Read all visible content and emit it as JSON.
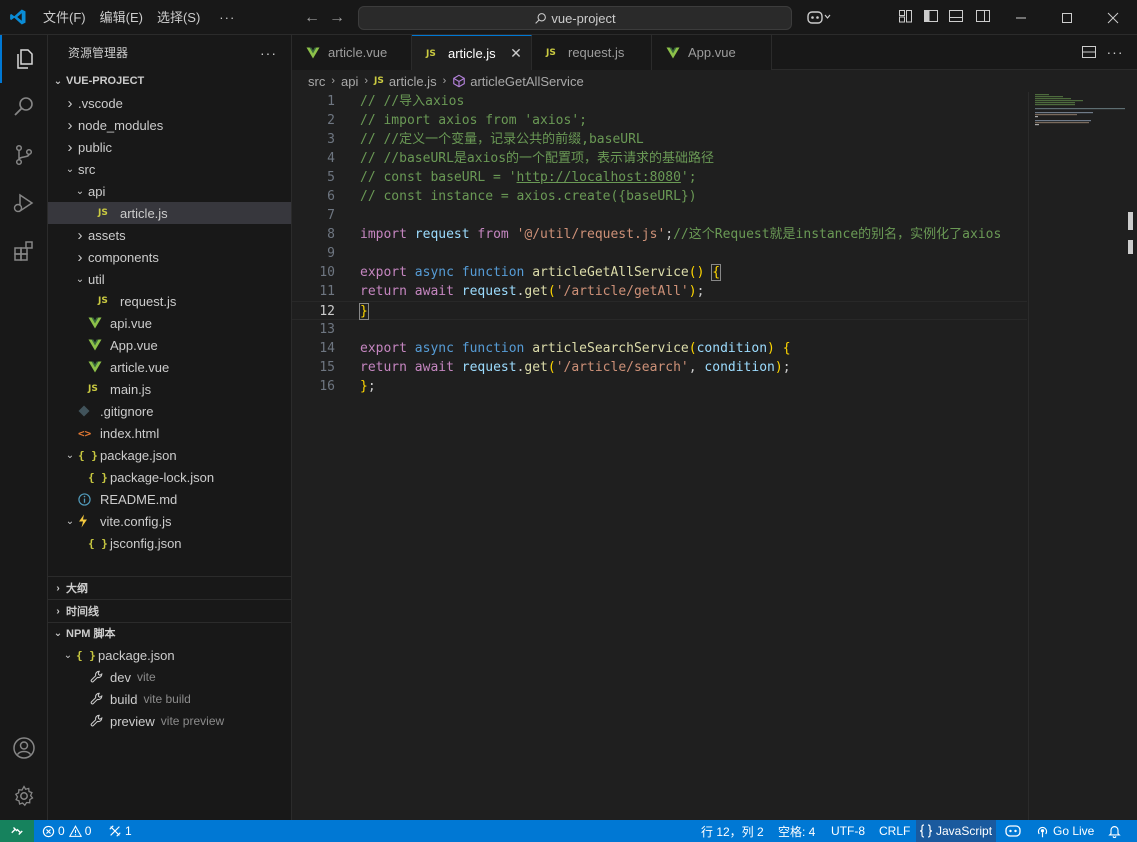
{
  "titlebar": {
    "menus": [
      "文件(F)",
      "编辑(E)",
      "选择(S)",
      "···"
    ],
    "search_text": "vue-project"
  },
  "sidebar": {
    "title": "资源管理器",
    "more": "···",
    "project": "VUE-PROJECT",
    "tree": [
      {
        "label": ".vscode",
        "indent": 1,
        "chev": "right",
        "icon": ""
      },
      {
        "label": "node_modules",
        "indent": 1,
        "chev": "right",
        "icon": ""
      },
      {
        "label": "public",
        "indent": 1,
        "chev": "right",
        "icon": ""
      },
      {
        "label": "src",
        "indent": 1,
        "chev": "down",
        "icon": ""
      },
      {
        "label": "api",
        "indent": 2,
        "chev": "down",
        "icon": ""
      },
      {
        "label": "article.js",
        "indent": 3,
        "chev": "",
        "icon": "js",
        "selected": true
      },
      {
        "label": "assets",
        "indent": 2,
        "chev": "right",
        "icon": ""
      },
      {
        "label": "components",
        "indent": 2,
        "chev": "right",
        "icon": ""
      },
      {
        "label": "util",
        "indent": 2,
        "chev": "down",
        "icon": ""
      },
      {
        "label": "request.js",
        "indent": 3,
        "chev": "",
        "icon": "js"
      },
      {
        "label": "api.vue",
        "indent": 2,
        "chev": "",
        "icon": "vue"
      },
      {
        "label": "App.vue",
        "indent": 2,
        "chev": "",
        "icon": "vue"
      },
      {
        "label": "article.vue",
        "indent": 2,
        "chev": "",
        "icon": "vue"
      },
      {
        "label": "main.js",
        "indent": 2,
        "chev": "",
        "icon": "js"
      },
      {
        "label": ".gitignore",
        "indent": 1,
        "chev": "",
        "icon": "git"
      },
      {
        "label": "index.html",
        "indent": 1,
        "chev": "",
        "icon": "html"
      },
      {
        "label": "package.json",
        "indent": 1,
        "chev": "down",
        "icon": "json"
      },
      {
        "label": "package-lock.json",
        "indent": 2,
        "chev": "",
        "icon": "json"
      },
      {
        "label": "README.md",
        "indent": 1,
        "chev": "",
        "icon": "info"
      },
      {
        "label": "vite.config.js",
        "indent": 1,
        "chev": "down",
        "icon": "vite"
      },
      {
        "label": "jsconfig.json",
        "indent": 2,
        "chev": "",
        "icon": "json"
      }
    ],
    "outline": "大纲",
    "timeline": "时间线",
    "npm": "NPM 脚本",
    "npm_pkg": "package.json",
    "scripts": [
      {
        "name": "dev",
        "cmd": "vite"
      },
      {
        "name": "build",
        "cmd": "vite build"
      },
      {
        "name": "preview",
        "cmd": "vite preview"
      }
    ]
  },
  "tabs": [
    {
      "label": "article.vue",
      "icon": "vue"
    },
    {
      "label": "article.js",
      "icon": "js",
      "active": true
    },
    {
      "label": "request.js",
      "icon": "js"
    },
    {
      "label": "App.vue",
      "icon": "vue"
    }
  ],
  "breadcrumb": {
    "parts": [
      "src",
      "api",
      "article.js",
      "articleGetAllService"
    ]
  },
  "editor": {
    "current_line": 12,
    "lines": [
      [
        [
          "c-com",
          "// //导入axios"
        ]
      ],
      [
        [
          "c-com",
          "// import axios from 'axios';"
        ]
      ],
      [
        [
          "c-com",
          "// //定义一个变量，记录公共的前缀,baseURL"
        ]
      ],
      [
        [
          "c-com",
          "// //baseURL是axios的一个配置项，表示请求的基础路径"
        ]
      ],
      [
        [
          "c-com",
          "// const baseURL = '"
        ],
        [
          "c-com u",
          "http://localhost:8080"
        ],
        [
          "c-com",
          "';"
        ]
      ],
      [
        [
          "c-com",
          "// const instance = axios.create({baseURL})"
        ]
      ],
      [],
      [
        [
          "c-ctl",
          "import"
        ],
        [
          "c-pun",
          " "
        ],
        [
          "c-var",
          "request"
        ],
        [
          "c-pun",
          " "
        ],
        [
          "c-ctl",
          "from"
        ],
        [
          "c-pun",
          " "
        ],
        [
          "c-str",
          "'@/util/request.js'"
        ],
        [
          "c-pun",
          ";"
        ],
        [
          "c-com",
          "//这个Request就是instance的别名，实例化了axios"
        ]
      ],
      [],
      [
        [
          "c-ctl",
          "export"
        ],
        [
          "c-pun",
          " "
        ],
        [
          "c-kw",
          "async"
        ],
        [
          "c-pun",
          " "
        ],
        [
          "c-kw",
          "function"
        ],
        [
          "c-pun",
          " "
        ],
        [
          "c-fn",
          "articleGetAllService"
        ],
        [
          "c-br",
          "()"
        ],
        [
          "c-pun",
          " "
        ],
        [
          "c-br bracket-box",
          "{"
        ]
      ],
      [
        [
          "c-ctl",
          "return"
        ],
        [
          "c-pun",
          " "
        ],
        [
          "c-ctl",
          "await"
        ],
        [
          "c-pun",
          " "
        ],
        [
          "c-var",
          "request"
        ],
        [
          "c-pun",
          "."
        ],
        [
          "c-fn",
          "get"
        ],
        [
          "c-br",
          "("
        ],
        [
          "c-str",
          "'/article/getAll'"
        ],
        [
          "c-br",
          ")"
        ],
        [
          "c-pun",
          ";"
        ]
      ],
      [
        [
          "c-br bracket-box",
          "}"
        ]
      ],
      [],
      [
        [
          "c-ctl",
          "export"
        ],
        [
          "c-pun",
          " "
        ],
        [
          "c-kw",
          "async"
        ],
        [
          "c-pun",
          " "
        ],
        [
          "c-kw",
          "function"
        ],
        [
          "c-pun",
          " "
        ],
        [
          "c-fn",
          "articleSearchService"
        ],
        [
          "c-br",
          "("
        ],
        [
          "c-var",
          "condition"
        ],
        [
          "c-br",
          ")"
        ],
        [
          "c-pun",
          " "
        ],
        [
          "c-br",
          "{"
        ]
      ],
      [
        [
          "c-ctl",
          "return"
        ],
        [
          "c-pun",
          " "
        ],
        [
          "c-ctl",
          "await"
        ],
        [
          "c-pun",
          " "
        ],
        [
          "c-var",
          "request"
        ],
        [
          "c-pun",
          "."
        ],
        [
          "c-fn",
          "get"
        ],
        [
          "c-br",
          "("
        ],
        [
          "c-str",
          "'/article/search'"
        ],
        [
          "c-pun",
          ", "
        ],
        [
          "c-var",
          "condition"
        ],
        [
          "c-br",
          ")"
        ],
        [
          "c-pun",
          ";"
        ]
      ],
      [
        [
          "c-br",
          "}"
        ],
        [
          "c-pun",
          ";"
        ]
      ]
    ]
  },
  "statusbar": {
    "errors": "0",
    "warnings": "0",
    "ports": "1",
    "position": "行 12，列 2",
    "spaces": "空格: 4",
    "encoding": "UTF-8",
    "eol": "CRLF",
    "language": "JavaScript",
    "golive": "Go Live"
  },
  "colors": {
    "accent": "#0078d4",
    "remote": "#16825d"
  }
}
